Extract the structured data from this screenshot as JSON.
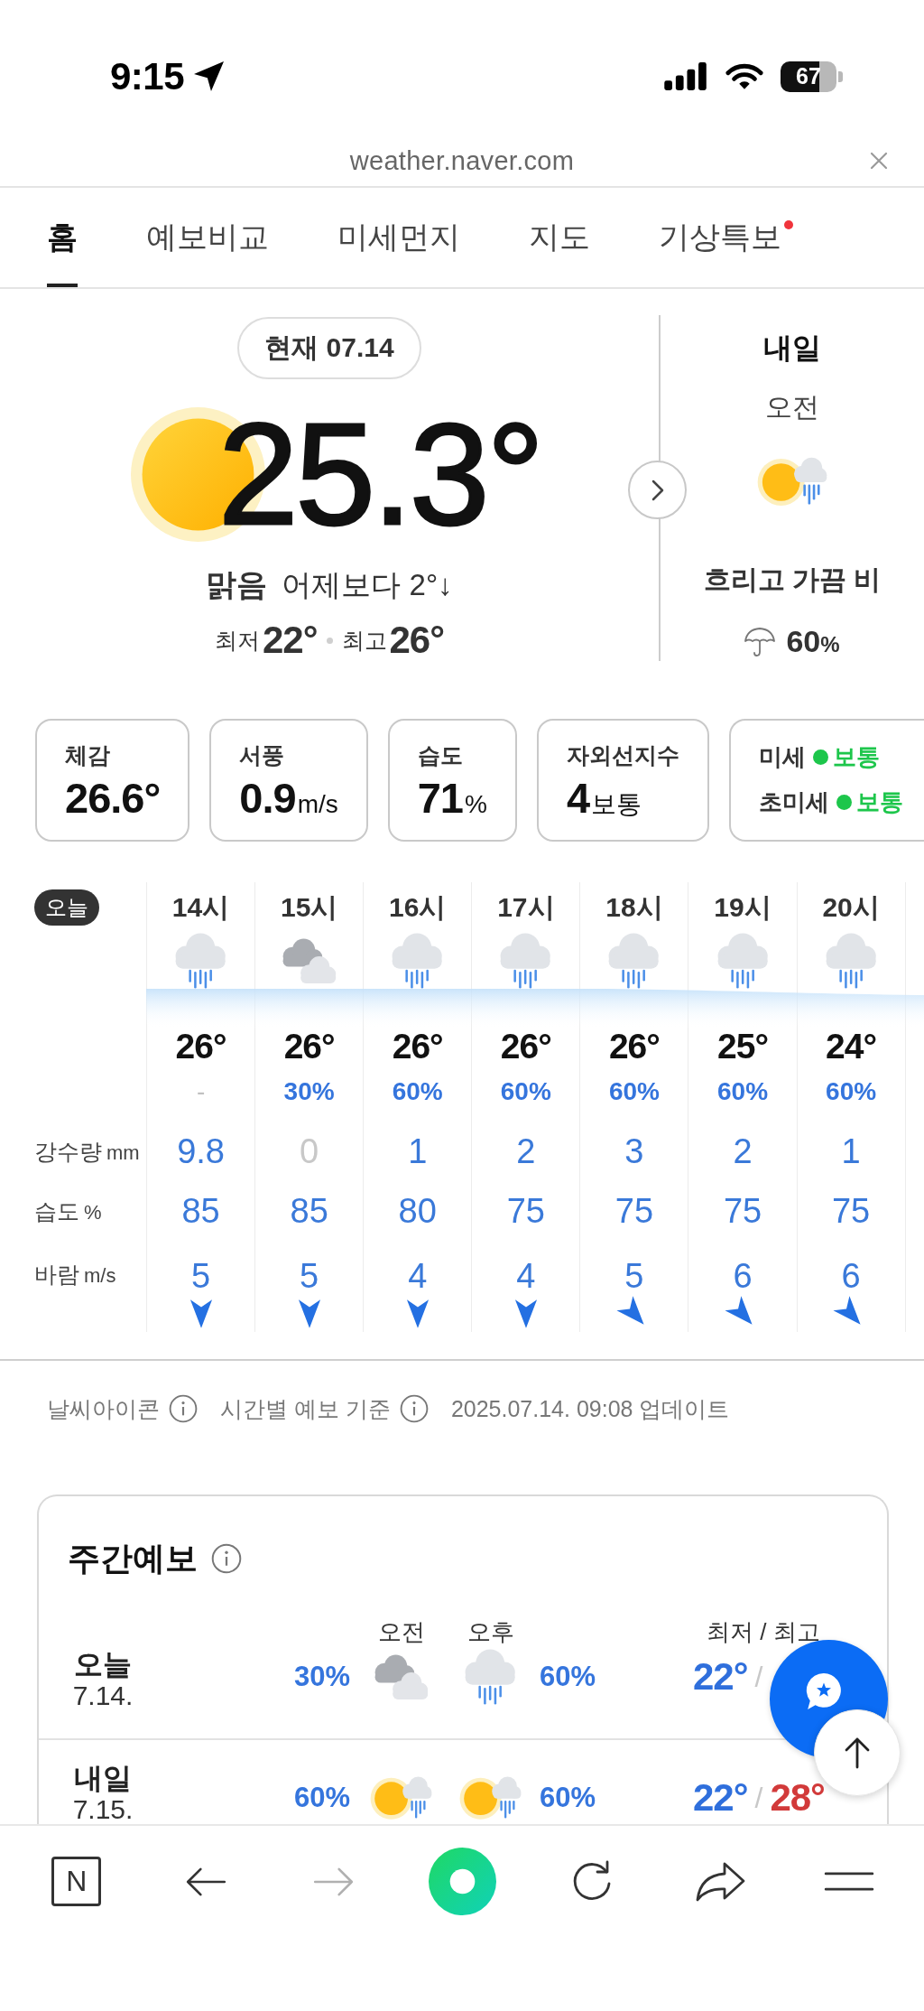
{
  "status_bar": {
    "time": "9:15",
    "battery": "67"
  },
  "browser": {
    "url": "weather.naver.com"
  },
  "tabs": [
    {
      "label": "홈",
      "selected": true,
      "alert": false
    },
    {
      "label": "예보비교",
      "selected": false,
      "alert": false
    },
    {
      "label": "미세먼지",
      "selected": false,
      "alert": false
    },
    {
      "label": "지도",
      "selected": false,
      "alert": false
    },
    {
      "label": "기상특보",
      "selected": false,
      "alert": true
    }
  ],
  "current": {
    "date": "현재 07.14",
    "temperature": "25.3°",
    "condition": "맑음",
    "comparison": "어제보다 2°↓",
    "low_label": "최저",
    "low": "22°",
    "high_label": "최고",
    "high": "26°"
  },
  "tomorrow": {
    "title": "내일",
    "period": "오전",
    "condition": "흐리고 가끔 비",
    "precip": "60",
    "precip_unit": "%"
  },
  "details": [
    {
      "kind": "metric",
      "label": "체감",
      "value": "26.6°"
    },
    {
      "kind": "metric",
      "label": "서풍",
      "value": "0.9",
      "unit": "m/s"
    },
    {
      "kind": "metric",
      "label": "습도",
      "value": "71",
      "unit": "%"
    },
    {
      "kind": "metric",
      "label": "자외선지수",
      "value": "4",
      "unit": "보통"
    },
    {
      "kind": "air",
      "lines": [
        {
          "label": "미세",
          "status": "보통",
          "color": "#1dc64b"
        },
        {
          "label": "초미세",
          "status": "보통",
          "color": "#1dc64b"
        }
      ]
    }
  ],
  "hourly": {
    "day": "오늘",
    "rows": [
      {
        "label": "강수량",
        "unit": "mm"
      },
      {
        "label": "습도",
        "unit": "%"
      },
      {
        "label": "바람",
        "unit": "m/s"
      }
    ],
    "hours": [
      {
        "kind": "rain",
        "time": "14시",
        "temp": "26°",
        "prob": "-",
        "prob_dim": true,
        "amount": "9.8",
        "amount_dim": false,
        "humidity": "85"
      },
      {
        "kind": "cloudy",
        "time": "15시",
        "temp": "26°",
        "prob": "30%",
        "prob_dim": false,
        "amount": "0",
        "amount_dim": true,
        "humidity": "85"
      },
      {
        "kind": "rain",
        "time": "16시",
        "temp": "26°",
        "prob": "60%",
        "prob_dim": false,
        "amount": "1",
        "amount_dim": false,
        "humidity": "80"
      },
      {
        "kind": "rain",
        "time": "17시",
        "temp": "26°",
        "prob": "60%",
        "prob_dim": false,
        "amount": "2",
        "amount_dim": false,
        "humidity": "75"
      },
      {
        "kind": "rain",
        "time": "18시",
        "temp": "26°",
        "prob": "60%",
        "prob_dim": false,
        "amount": "3",
        "amount_dim": false,
        "humidity": "75"
      },
      {
        "kind": "rain",
        "time": "19시",
        "temp": "25°",
        "prob": "60%",
        "prob_dim": false,
        "amount": "2",
        "amount_dim": false,
        "humidity": "75"
      },
      {
        "kind": "rain",
        "time": "20시",
        "temp": "24°",
        "prob": "60%",
        "prob_dim": false,
        "amount": "1",
        "amount_dim": false,
        "humidity": "75"
      }
    ],
    "winds": [
      {
        "kind": "south",
        "value": "5"
      },
      {
        "kind": "south",
        "value": "5"
      },
      {
        "kind": "south",
        "value": "4"
      },
      {
        "kind": "south",
        "value": "4"
      },
      {
        "kind": "southeast",
        "value": "5"
      },
      {
        "kind": "southeast",
        "value": "6"
      },
      {
        "kind": "southeast",
        "value": "6"
      }
    ]
  },
  "footer": [
    {
      "kind": "help",
      "text": "날씨아이콘"
    },
    {
      "kind": "help",
      "text": "시간별 예보 기준"
    },
    {
      "kind": "note",
      "text": "2025.07.14. 09:08 업데이트"
    }
  ],
  "weekly": {
    "title": "주간예보",
    "am": "오전",
    "pm": "오후",
    "range": "최저 / 최고",
    "days": [
      {
        "day": "오늘",
        "date": "7.14.",
        "periods": [
          {
            "kind": "cloudy",
            "prob": "30%"
          },
          {
            "kind": "rain",
            "prob": "60%"
          }
        ],
        "low": "22°",
        "sep": "/"
      },
      {
        "day": "내일",
        "date": "7.15.",
        "periods": [
          {
            "kind": "showers",
            "prob": "60%"
          },
          {
            "kind": "showers",
            "prob": "60%"
          }
        ],
        "low": "22°",
        "sep": "/",
        "high": "28°"
      }
    ]
  },
  "bottom_nav": [
    {
      "kind": "logo",
      "label": "N",
      "disabled": false
    },
    {
      "kind": "back",
      "disabled": false
    },
    {
      "kind": "forward",
      "disabled": true
    },
    {
      "kind": "ring",
      "disabled": false
    },
    {
      "kind": "reload",
      "disabled": false
    },
    {
      "kind": "share",
      "disabled": false
    },
    {
      "kind": "menu",
      "disabled": false
    }
  ]
}
